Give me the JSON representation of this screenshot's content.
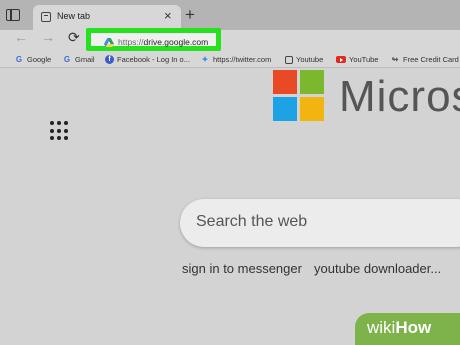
{
  "tab": {
    "title": "New tab",
    "close": "×",
    "new_tab": "+"
  },
  "toolbar": {
    "back": "←",
    "forward": "→",
    "refresh": "⟳",
    "address_scheme": "https://",
    "address_host": "drive.google.com",
    "highlight_color": "#26e11f"
  },
  "favorites": [
    {
      "label": "Google",
      "icon": "google-icon"
    },
    {
      "label": "Gmail",
      "icon": "google-icon"
    },
    {
      "label": "Facebook - Log In o...",
      "icon": "facebook-icon"
    },
    {
      "label": "https://twitter.com",
      "icon": "twitter-icon"
    },
    {
      "label": "Youtube",
      "icon": "page-icon"
    },
    {
      "label": "YouTube",
      "icon": "youtube-icon"
    },
    {
      "label": "Free Credit Card",
      "icon": "credit-card-icon"
    }
  ],
  "page": {
    "brand": "Micros",
    "search_placeholder": "Search the web",
    "suggestions": [
      "sign in to messenger",
      "youtube downloader..."
    ]
  },
  "watermark": {
    "prefix": "wiki",
    "suffix": "How",
    "color": "#7db34a"
  }
}
